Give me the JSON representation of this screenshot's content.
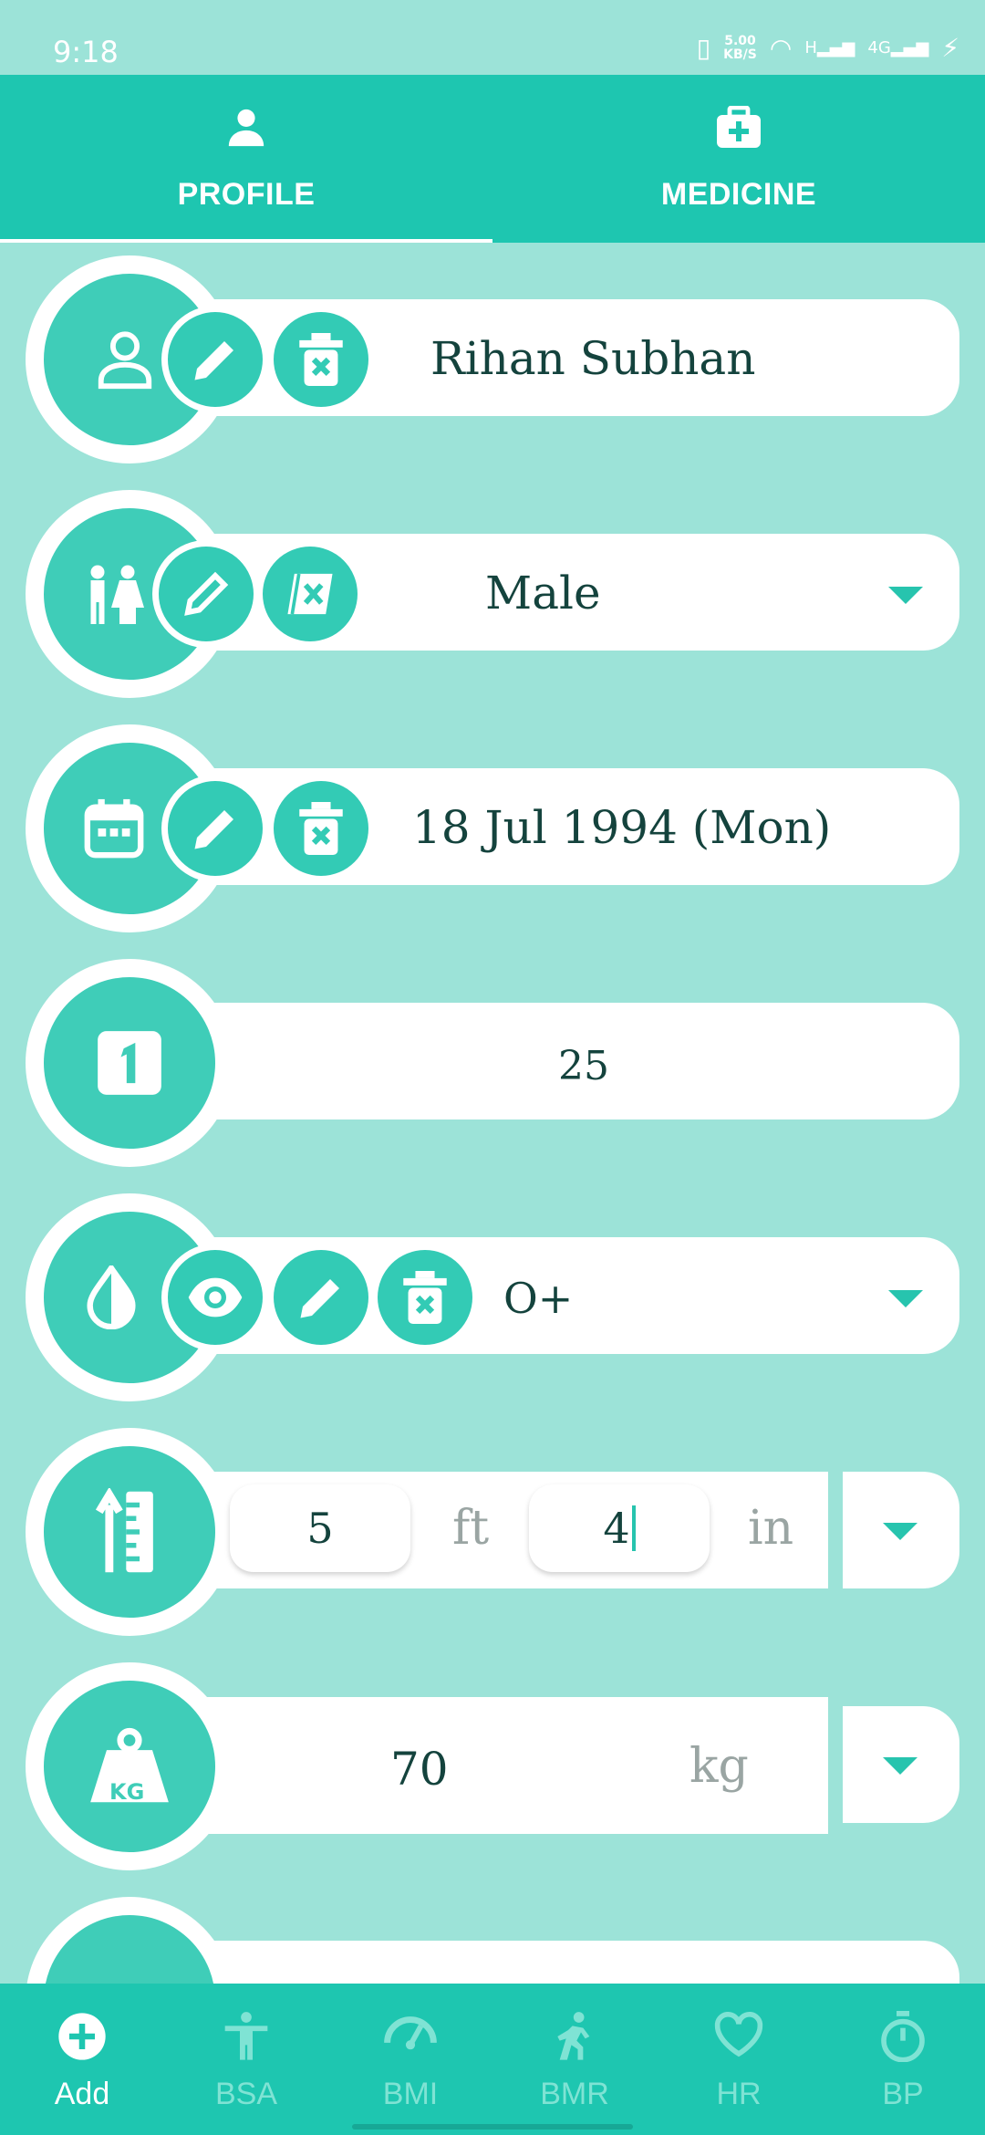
{
  "status": {
    "time": "9:18",
    "speed": "5.00",
    "speed_unit": "KB/S",
    "net_h": "H",
    "net_4g": "4G"
  },
  "tabs": [
    {
      "label": "PROFILE",
      "icon": "person-icon",
      "active": true
    },
    {
      "label": "MEDICINE",
      "icon": "briefcase-medical-icon",
      "active": false
    }
  ],
  "profile": {
    "name": "Rihan Subhan",
    "gender": "Male",
    "dob": "18 Jul 1994 (Mon)",
    "age": "25",
    "blood_group": "O+",
    "height_ft": "5",
    "height_ft_unit": "ft",
    "height_in": "4",
    "height_in_unit": "in",
    "weight": "70",
    "weight_unit": "kg",
    "weight_icon_text": "KG"
  },
  "bottom_nav": [
    {
      "label": "Add",
      "icon": "add-circle-icon",
      "active": true
    },
    {
      "label": "BSA",
      "icon": "body-icon",
      "active": false
    },
    {
      "label": "BMI",
      "icon": "gauge-icon",
      "active": false
    },
    {
      "label": "BMR",
      "icon": "running-icon",
      "active": false
    },
    {
      "label": "HR",
      "icon": "heart-icon",
      "active": false
    },
    {
      "label": "BP",
      "icon": "stopwatch-icon",
      "active": false
    }
  ],
  "colors": {
    "accent": "#1ec6b0",
    "background": "#9ce3d8",
    "text_dark": "#14433d"
  }
}
